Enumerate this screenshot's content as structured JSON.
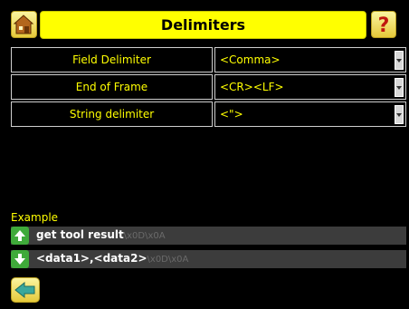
{
  "header": {
    "title": "Delimiters",
    "home_icon": "home-icon",
    "help_icon": "help-icon"
  },
  "settings": [
    {
      "label": "Field Delimiter",
      "value": "<Comma>"
    },
    {
      "label": "End of Frame",
      "value": "<CR><LF>"
    },
    {
      "label": "String delimiter",
      "value": "<\">"
    }
  ],
  "example": {
    "label": "Example",
    "rows": [
      {
        "icon": "upload-arrow-icon",
        "text": "get tool result",
        "ctrl": "\\x0D\\x0A"
      },
      {
        "icon": "download-arrow-icon",
        "text": "<data1>,<data2>",
        "ctrl": "\\x0D\\x0A"
      }
    ]
  },
  "footer": {
    "back_icon": "back-arrow-icon"
  },
  "colors": {
    "accent": "#ffff00",
    "row_bg": "#3c3c3c",
    "arrow_green": "#3faa3a"
  }
}
